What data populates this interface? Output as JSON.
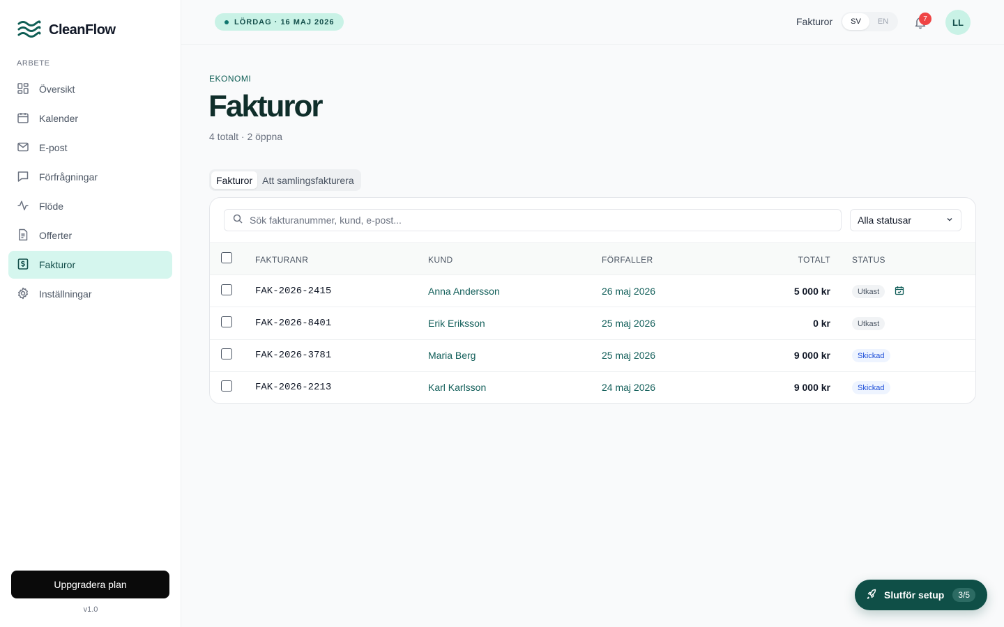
{
  "brand": {
    "name": "CleanFlow"
  },
  "sidebar": {
    "section_label": "ARBETE",
    "items": [
      {
        "label": "Översikt",
        "icon": "grid-icon"
      },
      {
        "label": "Kalender",
        "icon": "calendar-icon"
      },
      {
        "label": "E-post",
        "icon": "mail-icon"
      },
      {
        "label": "Förfrågningar",
        "icon": "message-icon"
      },
      {
        "label": "Flöde",
        "icon": "activity-icon"
      },
      {
        "label": "Offerter",
        "icon": "document-icon"
      },
      {
        "label": "Fakturor",
        "icon": "invoice-icon",
        "active": true
      },
      {
        "label": "Inställningar",
        "icon": "gear-icon"
      }
    ],
    "upgrade_label": "Uppgradera plan",
    "version": "v1.0"
  },
  "topbar": {
    "date": "LÖRDAG · 16 MAJ 2026",
    "title": "Fakturor",
    "languages": [
      "SV",
      "EN"
    ],
    "active_language": "SV",
    "notification_count": "7",
    "avatar_initials": "LL"
  },
  "page": {
    "eyebrow": "EKONOMI",
    "title": "Fakturor",
    "subtitle": "4 totalt · 2 öppna",
    "tabs": [
      "Fakturor",
      "Att samlingsfakturera"
    ],
    "active_tab": "Fakturor"
  },
  "filters": {
    "search_placeholder": "Sök fakturanummer, kund, e-post...",
    "status_value": "Alla statusar"
  },
  "table": {
    "columns": [
      "FAKTURANR",
      "KUND",
      "FÖRFALLER",
      "TOTALT",
      "STATUS"
    ],
    "rows": [
      {
        "number": "FAK-2026-2415",
        "customer": "Anna Andersson",
        "due": "26 maj 2026",
        "total": "5 000 kr",
        "status": "Utkast",
        "status_kind": "draft",
        "scheduled": true
      },
      {
        "number": "FAK-2026-8401",
        "customer": "Erik Eriksson",
        "due": "25 maj 2026",
        "total": "0 kr",
        "status": "Utkast",
        "status_kind": "draft"
      },
      {
        "number": "FAK-2026-3781",
        "customer": "Maria Berg",
        "due": "25 maj 2026",
        "total": "9 000 kr",
        "status": "Skickad",
        "status_kind": "sent"
      },
      {
        "number": "FAK-2026-2213",
        "customer": "Karl Karlsson",
        "due": "24 maj 2026",
        "total": "9 000 kr",
        "status": "Skickad",
        "status_kind": "sent"
      }
    ]
  },
  "setup": {
    "label": "Slutför setup",
    "progress": "3/5"
  },
  "colors": {
    "accent": "#0f4f47",
    "active_nav_bg": "#d5f6ee",
    "date_pill_bg": "#c9f2e6",
    "badge": "#ef4444"
  }
}
